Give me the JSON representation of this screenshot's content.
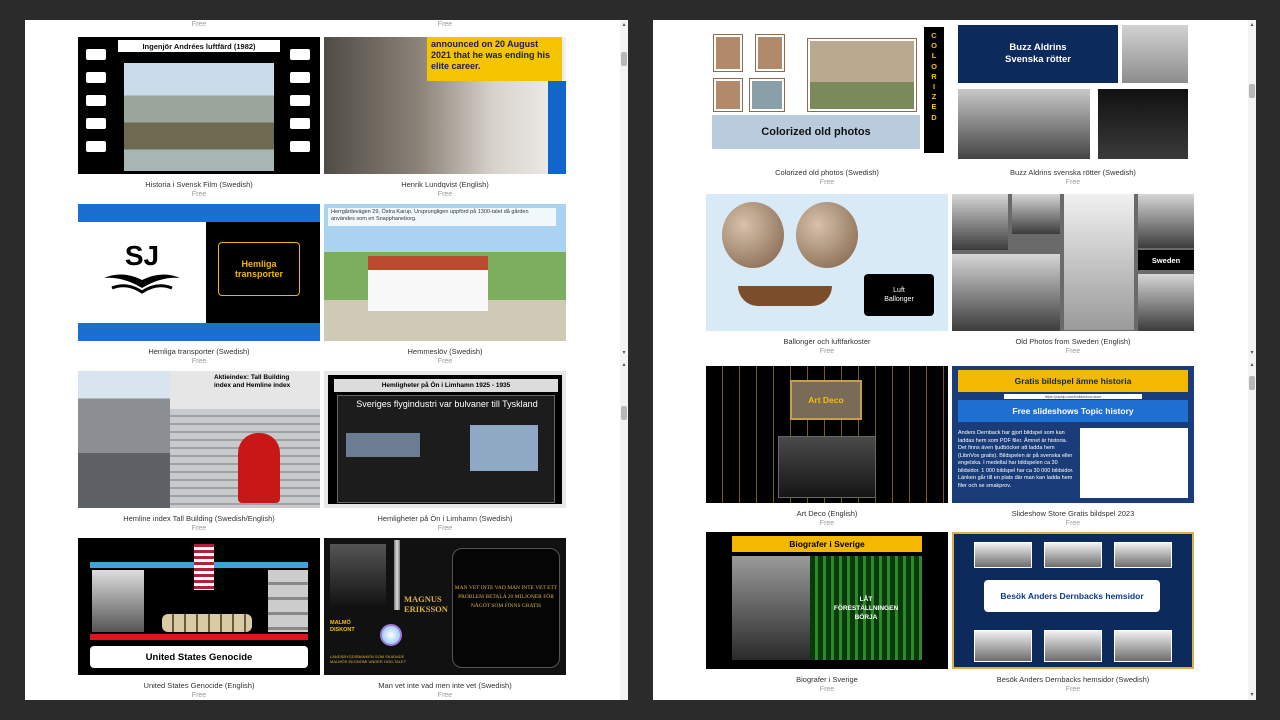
{
  "left_panel": {
    "top_prices": [
      "Free",
      "Free"
    ],
    "cards": [
      {
        "caption": "Historia i Svensk Film (Swedish)",
        "price": "Free",
        "thumb_text": "Ingenjör Andrées luftfärd (1982)"
      },
      {
        "caption": "Henrik Lundqvist (English)",
        "price": "Free",
        "thumb_text": "announced on 20 August 2021 that he was ending his elite career."
      },
      {
        "caption": "Hemliga transporter (Swedish)",
        "price": "Free",
        "thumb_text": "Hemliga transporter",
        "logo_text": "SJ"
      },
      {
        "caption": "Hemmeslöv (Swedish)",
        "price": "Free",
        "thumb_text": "Herrgårdevägen 29, Östra Karup, Ursprungligen uppförd på 1300-talet då gården användes som en Snapphaneborg."
      },
      {
        "caption": "Hemline index Tall Building (Swedish/English)",
        "price": "Free",
        "thumb_text": "Aktieindex: Tall Building index and Hemline index"
      },
      {
        "caption": "Hemligheter på Ön i Limhamn (Swedish)",
        "price": "Free",
        "thumb_title": "Hemligheter på Ön i Limhamn 1925 - 1935",
        "thumb_text": "Sveriges flygindustri var bulvaner till Tyskland"
      },
      {
        "caption": "United States Genocide (English)",
        "price": "Free",
        "thumb_text": "United States Genocide"
      },
      {
        "caption": "Man vet inte vad men inte vet (Swedish)",
        "price": "Free",
        "thumb_text": "MAN VET INTE VAD MAN INTE VET ETT PROBLEM BETALA 20 MILJONER FÖR NÅGOT SOM FINNS GRATIS",
        "thumb_name": "MAGNUS ERIKSSON",
        "thumb_side": "MALMÖ DISKONT",
        "thumb_small": "LANDSBYGDSBANKEN SOM SKADADE MALMÖS EKONOMI UNDER 1930-TALET"
      }
    ]
  },
  "right_panel": {
    "cards": [
      {
        "caption": "Colorized old photos (Swedish)",
        "price": "Free",
        "thumb_text": "Colorized old photos",
        "thumb_vertical": "COLORIZED"
      },
      {
        "caption": "Buzz Aldrins svenska rötter (Swedish)",
        "price": "Free",
        "thumb_text": "Buzz Aldrins Svenska rötter"
      },
      {
        "caption": "Ballonger och luftfarkoster",
        "price": "Free",
        "thumb_text": "Luft Ballonger"
      },
      {
        "caption": "Old Photos from Sweden (English)",
        "price": "Free",
        "thumb_text": "Sweden"
      },
      {
        "caption": "Art Deco (English)",
        "price": "Free",
        "thumb_text": "Art Deco"
      },
      {
        "caption": "Slideshow Store Gratis bildspel 2023",
        "price": "Free",
        "thumb_title": "Gratis bildspel ämne historia",
        "thumb_subtitle": "Free slideshows Topic history",
        "thumb_url": "https://payhip.com/b/slideshow-store",
        "thumb_text": "Anders Dernback har gjort bildspel som kan laddas hem som PDF filer. Ämnet är historia. Det finns även ljudböcker att ladda hem (LibriVox gratis). Bildspelen är på svenska eller engelska. I medeltal har bildspelen ca 30 bildsidor. 1 000 bildspel har ca 30 000 bildsidor. Länken går till en plats där man kan ladda hem filer och se smakprov."
      },
      {
        "caption": "Biografer i Sverige",
        "price": "Free",
        "thumb_title": "Biografer i Sverige",
        "thumb_text": "LÅT FÖRESTÄLLNINGEN BÖRJA"
      },
      {
        "caption": "Besök Anders Dernbacks hemsidor (Swedish)",
        "price": "Free",
        "thumb_text": "Besök Anders Dernbacks hemsidor"
      }
    ]
  }
}
